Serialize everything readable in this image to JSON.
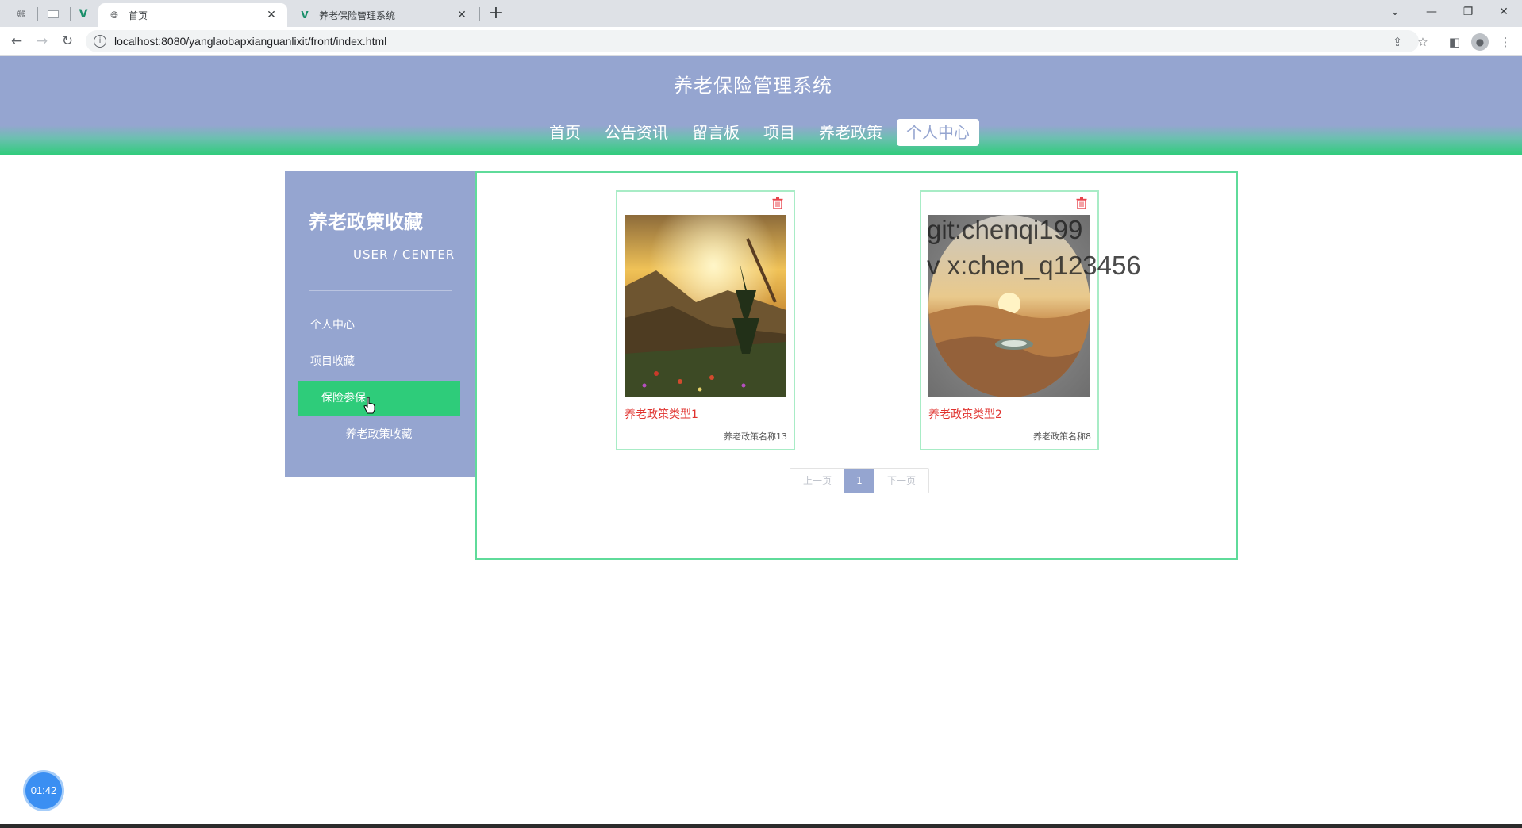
{
  "browser": {
    "tabs": [
      {
        "title": "首页",
        "active": true
      },
      {
        "title": "养老保险管理系统",
        "active": false
      }
    ],
    "url": "localhost:8080/yanglaobapxianguanlixit/front/index.html"
  },
  "site": {
    "title": "养老保险管理系统",
    "nav": [
      {
        "label": "首页"
      },
      {
        "label": "公告资讯"
      },
      {
        "label": "留言板"
      },
      {
        "label": "项目"
      },
      {
        "label": "养老政策"
      },
      {
        "label": "个人中心",
        "active": true
      }
    ]
  },
  "sidebar": {
    "title": "养老政策收藏",
    "subtitle": "USER / CENTER",
    "items": [
      {
        "label": "个人中心"
      },
      {
        "label": "项目收藏"
      },
      {
        "label": "保险参保",
        "active": true
      },
      {
        "label": "养老政策收藏"
      }
    ]
  },
  "cards": [
    {
      "title": "养老政策类型1",
      "subtitle": "养老政策名称13",
      "image": "mountain-sunset"
    },
    {
      "title": "养老政策类型2",
      "subtitle": "养老政策名称8",
      "image": "desert-oasis"
    }
  ],
  "watermark": {
    "line1": "git:chenqi199",
    "line2": "v x:chen_q123456"
  },
  "pagination": {
    "prev": "上一页",
    "current": "1",
    "next": "下一页"
  },
  "timer": "01:42",
  "colors": {
    "header": "#95a5d0",
    "accent_green": "#2ecc7a",
    "card_title": "#e0322e"
  }
}
